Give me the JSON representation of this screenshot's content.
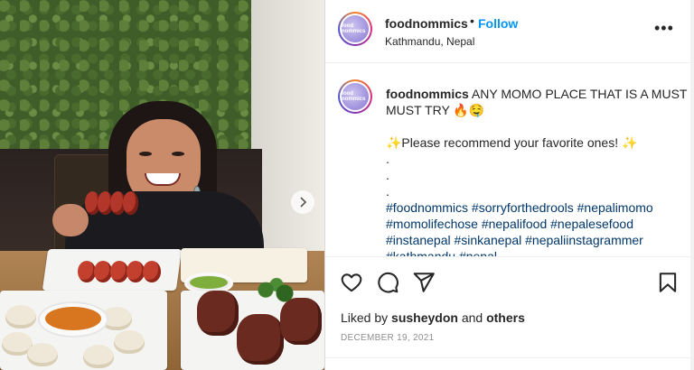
{
  "post": {
    "username": "foodnommics",
    "separator": "•",
    "follow_label": "Follow",
    "location": "Kathmandu, Nepal",
    "more_label": "•••",
    "avatar_text": "food nommics"
  },
  "caption": {
    "username": "foodnommics",
    "text_line1": " ANY MOMO PLACE THAT IS A MUST",
    "text_line2": "MUST TRY 🔥🤤",
    "recommend": "✨Please recommend your favorite ones! ✨",
    "dots": [
      ".",
      ".",
      "."
    ],
    "hashtag_lines": [
      "#foodnommics #sorryforthedrools #nepalimomo",
      "#momolifechose #nepalifood #nepalesefood",
      "#instanepal #sinkanepal #nepaliinstagrammer",
      "#kathmandu #nepal"
    ]
  },
  "engagement": {
    "liked_by_prefix": "Liked by ",
    "liked_by_user": "susheydon",
    "liked_by_and": " and ",
    "liked_by_others": "others",
    "date": "DECEMBER 19, 2021"
  },
  "icons": {
    "like": "heart-icon",
    "comment": "comment-icon",
    "share": "share-icon",
    "save": "bookmark-icon",
    "next": "chevron-right-icon"
  },
  "colors": {
    "accent": "#0095f6",
    "hashtag": "#00376b",
    "muted": "#8e8e8e"
  }
}
